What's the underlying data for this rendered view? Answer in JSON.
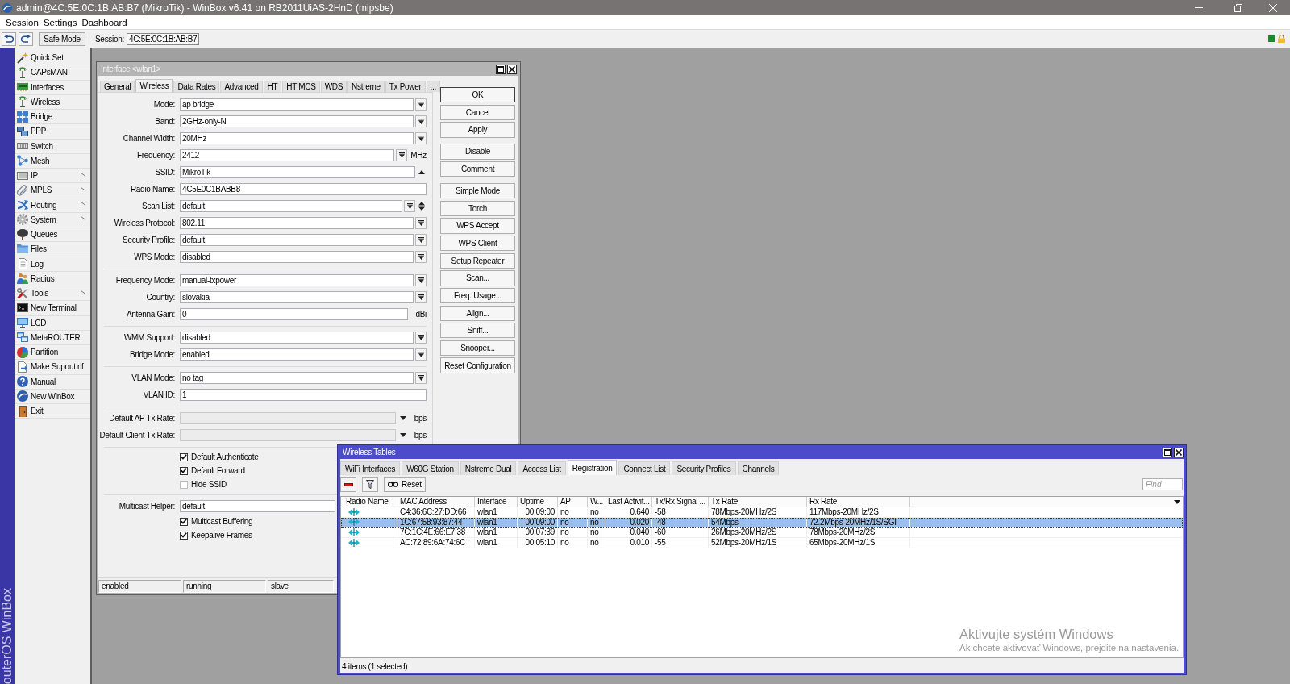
{
  "window": {
    "title": "admin@4C:5E:0C:1B:AB:B7 (MikroTik) - WinBox v6.41 on RB2011UiAS-2HnD (mipsbe)"
  },
  "menu": [
    "Session",
    "Settings",
    "Dashboard"
  ],
  "toolbar": {
    "safe_mode": "Safe Mode",
    "session_label": "Session:",
    "session_value": "4C:5E:0C:1B:AB:B7"
  },
  "sidebar": {
    "brand": "outerOS WinBox",
    "items": [
      {
        "label": "Quick Set",
        "submenu": false
      },
      {
        "label": "CAPsMAN",
        "submenu": false
      },
      {
        "label": "Interfaces",
        "submenu": false
      },
      {
        "label": "Wireless",
        "submenu": false
      },
      {
        "label": "Bridge",
        "submenu": false
      },
      {
        "label": "PPP",
        "submenu": false
      },
      {
        "label": "Switch",
        "submenu": false
      },
      {
        "label": "Mesh",
        "submenu": false
      },
      {
        "label": "IP",
        "submenu": true
      },
      {
        "label": "MPLS",
        "submenu": true
      },
      {
        "label": "Routing",
        "submenu": true
      },
      {
        "label": "System",
        "submenu": true
      },
      {
        "label": "Queues",
        "submenu": false
      },
      {
        "label": "Files",
        "submenu": false
      },
      {
        "label": "Log",
        "submenu": false
      },
      {
        "label": "Radius",
        "submenu": false
      },
      {
        "label": "Tools",
        "submenu": true
      },
      {
        "label": "New Terminal",
        "submenu": false
      },
      {
        "label": "LCD",
        "submenu": false
      },
      {
        "label": "MetaROUTER",
        "submenu": false
      },
      {
        "label": "Partition",
        "submenu": false
      },
      {
        "label": "Make Supout.rif",
        "submenu": false
      },
      {
        "label": "Manual",
        "submenu": false
      },
      {
        "label": "New WinBox",
        "submenu": false
      },
      {
        "label": "Exit",
        "submenu": false
      }
    ]
  },
  "interface_window": {
    "title": "Interface <wlan1>",
    "tabs": [
      {
        "label": "General",
        "selected": false
      },
      {
        "label": "Wireless",
        "selected": true
      },
      {
        "label": "Data Rates",
        "selected": false
      },
      {
        "label": "Advanced",
        "selected": false
      },
      {
        "label": "HT",
        "selected": false
      },
      {
        "label": "HT MCS",
        "selected": false
      },
      {
        "label": "WDS",
        "selected": false
      },
      {
        "label": "Nstreme",
        "selected": false
      },
      {
        "label": "Tx Power",
        "selected": false
      },
      {
        "label": "...",
        "selected": false
      }
    ],
    "groups": [
      {
        "rows": [
          {
            "kind": "select",
            "label": "Mode:",
            "value": "ap bridge"
          },
          {
            "kind": "select",
            "label": "Band:",
            "value": "2GHz-only-N"
          },
          {
            "kind": "select",
            "label": "Channel Width:",
            "value": "20MHz"
          },
          {
            "kind": "select_unit",
            "label": "Frequency:",
            "value": "2412",
            "unit": "MHz"
          },
          {
            "kind": "collapse",
            "label": "SSID:",
            "value": "MikroTik"
          },
          {
            "kind": "text",
            "label": "Radio Name:",
            "value": "4C5E0C1BABB8"
          },
          {
            "kind": "combo_spin",
            "label": "Scan List:",
            "value": "default"
          },
          {
            "kind": "select",
            "label": "Wireless Protocol:",
            "value": "802.11"
          },
          {
            "kind": "select",
            "label": "Security Profile:",
            "value": "default"
          },
          {
            "kind": "select",
            "label": "WPS Mode:",
            "value": "disabled"
          }
        ]
      },
      {
        "rows": [
          {
            "kind": "select",
            "label": "Frequency Mode:",
            "value": "manual-txpower"
          },
          {
            "kind": "select",
            "label": "Country:",
            "value": "slovakia"
          },
          {
            "kind": "text_unit",
            "label": "Antenna Gain:",
            "value": "0",
            "unit": "dBi"
          }
        ]
      },
      {
        "rows": [
          {
            "kind": "select",
            "label": "WMM Support:",
            "value": "disabled"
          },
          {
            "kind": "select",
            "label": "Bridge Mode:",
            "value": "enabled"
          }
        ]
      },
      {
        "rows": [
          {
            "kind": "select",
            "label": "VLAN Mode:",
            "value": "no tag"
          },
          {
            "kind": "text",
            "label": "VLAN ID:",
            "value": "1"
          }
        ]
      },
      {
        "rows": [
          {
            "kind": "rate",
            "label": "Default AP Tx Rate:",
            "unit": "bps"
          },
          {
            "kind": "rate",
            "label": "Default Client Tx Rate:",
            "unit": "bps"
          }
        ]
      },
      {
        "rows": [
          {
            "kind": "checkbox",
            "label": "Default Authenticate",
            "checked": true
          },
          {
            "kind": "checkbox",
            "label": "Default Forward",
            "checked": true
          },
          {
            "kind": "checkbox",
            "label": "Hide SSID",
            "checked": false
          }
        ]
      },
      {
        "rows": [
          {
            "kind": "text",
            "label": "Multicast Helper:",
            "value": "default"
          },
          {
            "kind": "checkbox",
            "label": "Multicast Buffering",
            "checked": true
          },
          {
            "kind": "checkbox",
            "label": "Keepalive Frames",
            "checked": true
          }
        ]
      }
    ],
    "buttons": [
      [
        {
          "label": "OK",
          "default": true
        },
        {
          "label": "Cancel",
          "default": false
        },
        {
          "label": "Apply",
          "default": false
        }
      ],
      [
        {
          "label": "Disable",
          "default": false
        },
        {
          "label": "Comment",
          "default": false
        }
      ],
      [
        {
          "label": "Simple Mode",
          "default": false
        },
        {
          "label": "Torch",
          "default": false
        },
        {
          "label": "WPS Accept",
          "default": false
        },
        {
          "label": "WPS Client",
          "default": false
        },
        {
          "label": "Setup Repeater",
          "default": false
        },
        {
          "label": "Scan...",
          "default": false
        },
        {
          "label": "Freq. Usage...",
          "default": false
        },
        {
          "label": "Align...",
          "default": false
        },
        {
          "label": "Sniff...",
          "default": false
        },
        {
          "label": "Snooper...",
          "default": false
        },
        {
          "label": "Reset Configuration",
          "default": false
        }
      ]
    ],
    "status": [
      "enabled",
      "running",
      "slave"
    ]
  },
  "wireless_window": {
    "title": "Wireless Tables",
    "tabs": [
      {
        "label": "WiFi Interfaces",
        "selected": false
      },
      {
        "label": "W60G Station",
        "selected": false
      },
      {
        "label": "Nstreme Dual",
        "selected": false
      },
      {
        "label": "Access List",
        "selected": false
      },
      {
        "label": "Registration",
        "selected": true
      },
      {
        "label": "Connect List",
        "selected": false
      },
      {
        "label": "Security Profiles",
        "selected": false
      },
      {
        "label": "Channels",
        "selected": false
      }
    ],
    "reset_button": "Reset",
    "find_placeholder": "Find",
    "columns": [
      "Radio Name",
      "MAC Address",
      "Interface",
      "Uptime",
      "AP",
      "W...",
      "Last Activit...",
      "Tx/Rx Signal ...",
      "Tx Rate",
      "Rx Rate"
    ],
    "rows": [
      {
        "selected": false,
        "cells": [
          "",
          "C4:36:6C:27:DD:66",
          "wlan1",
          "00:09:00",
          "no",
          "no",
          "0.640",
          "-58",
          "78Mbps-20MHz/2S",
          "117Mbps-20MHz/2S"
        ]
      },
      {
        "selected": true,
        "cells": [
          "",
          "1C:67:58:93:87:44",
          "wlan1",
          "00:09:00",
          "no",
          "no",
          "0.020",
          "-48",
          "54Mbps",
          "72.2Mbps-20MHz/1S/SGI"
        ]
      },
      {
        "selected": false,
        "cells": [
          "",
          "7C:1C:4E:66:E7:38",
          "wlan1",
          "00:07:39",
          "no",
          "no",
          "0.040",
          "-60",
          "26Mbps-20MHz/2S",
          "78Mbps-20MHz/2S"
        ]
      },
      {
        "selected": false,
        "cells": [
          "",
          "AC:72:89:6A:74:6C",
          "wlan1",
          "00:05:10",
          "no",
          "no",
          "0.010",
          "-55",
          "52Mbps-20MHz/1S",
          "65Mbps-20MHz/1S"
        ]
      }
    ],
    "status": "4 items (1 selected)"
  },
  "activation_notice": {
    "title": "Aktivujte systém Windows",
    "text": "Ak chcete aktivovať Windows, prejdite na nastavenia."
  }
}
